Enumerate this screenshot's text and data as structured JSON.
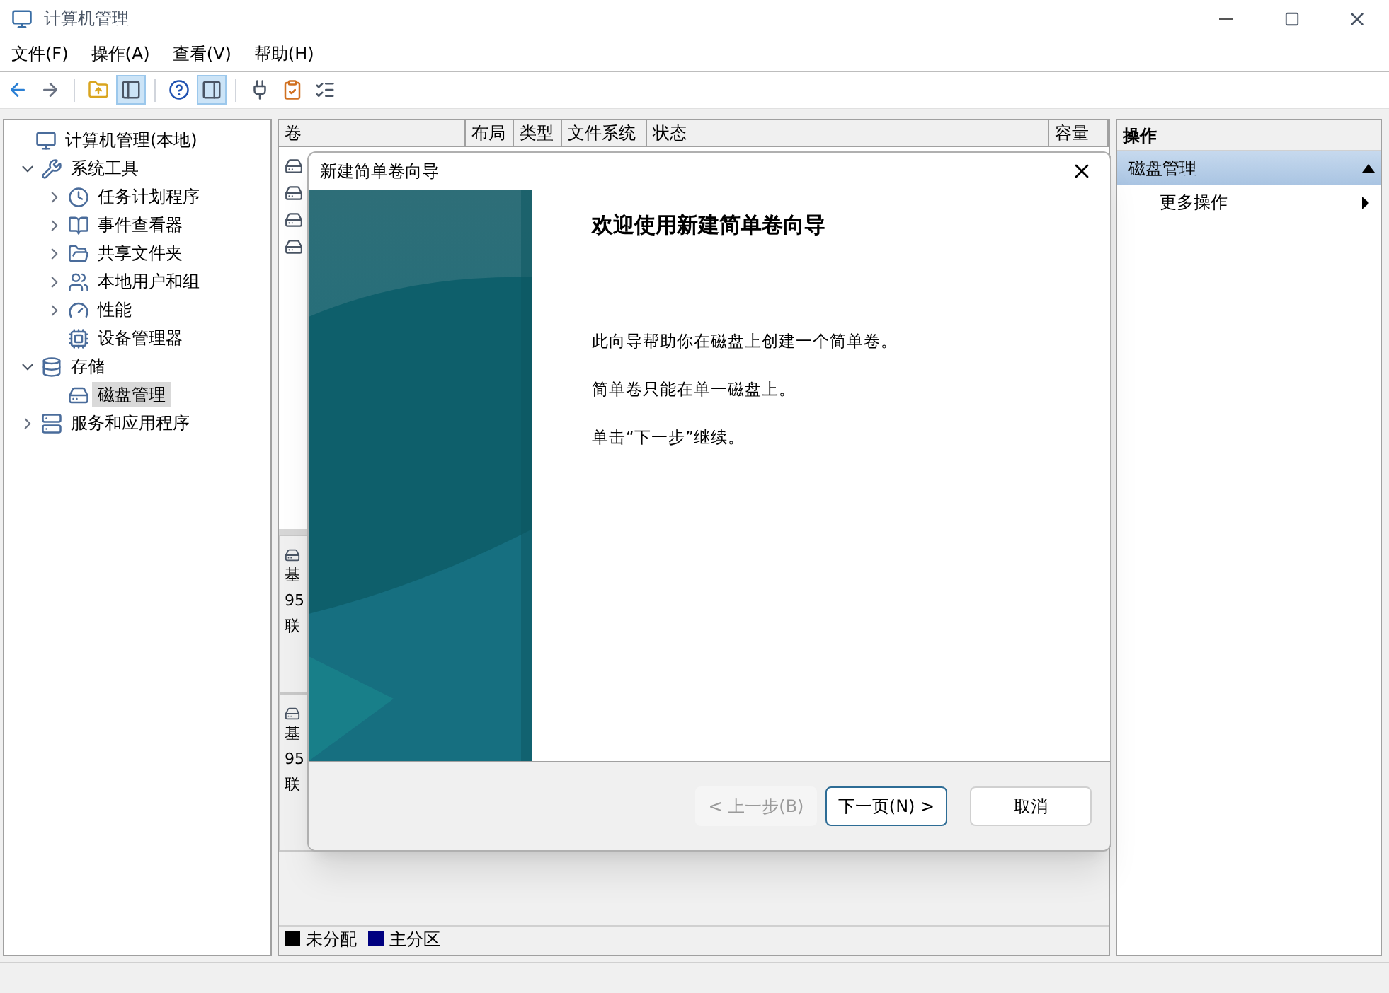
{
  "window": {
    "title": "计算机管理"
  },
  "menu": [
    "文件(F)",
    "操作(A)",
    "查看(V)",
    "帮助(H)"
  ],
  "toolbar": [
    {
      "pressed": false
    },
    {
      "pressed": false
    },
    {
      "pressed": false
    },
    {
      "pressed": true
    },
    {
      "pressed": false
    },
    {
      "pressed": true
    },
    {
      "pressed": false
    },
    {
      "pressed": false
    },
    {
      "pressed": false
    }
  ],
  "tree": [
    {
      "label": "计算机管理(本地)",
      "selected": false,
      "children": [
        {
          "label": "系统工具",
          "selected": false,
          "expanded": true,
          "children": [
            {
              "label": "任务计划程序",
              "selected": false,
              "expanded": false
            },
            {
              "label": "事件查看器",
              "selected": false,
              "expanded": false
            },
            {
              "label": "共享文件夹",
              "selected": false,
              "expanded": false
            },
            {
              "label": "本地用户和组",
              "selected": false,
              "expanded": false
            },
            {
              "label": "性能",
              "selected": false,
              "expanded": false
            },
            {
              "label": "设备管理器",
              "selected": false
            }
          ]
        },
        {
          "label": "存储",
          "selected": false,
          "expanded": true,
          "children": [
            {
              "label": "磁盘管理",
              "selected": true
            }
          ]
        },
        {
          "label": "服务和应用程序",
          "selected": false,
          "expanded": false
        }
      ]
    }
  ],
  "volume_table": {
    "columns": [
      "卷",
      "布局",
      "类型",
      "文件系统",
      "状态",
      "容量"
    ]
  },
  "disks": [
    {
      "lines": [
        "基",
        "95",
        "联"
      ]
    },
    {
      "lines": [
        "基",
        "95",
        "联"
      ]
    }
  ],
  "legend": [
    {
      "label": "未分配",
      "color": "#000000"
    },
    {
      "label": "主分区",
      "color": "#000080"
    }
  ],
  "actions": {
    "title": "操作",
    "section": {
      "label": "磁盘管理",
      "expanded": true
    },
    "items": [
      {
        "label": "更多操作"
      }
    ]
  },
  "dialog": {
    "title": "新建简单卷向导",
    "heading": "欢迎使用新建简单卷向导",
    "paragraphs": [
      "此向导帮助你在磁盘上创建一个简单卷。",
      "简单卷只能在单一磁盘上。",
      "单击“下一步”继续。"
    ],
    "buttons": [
      {
        "label": "< 上一步(B)",
        "disabled": true,
        "default": false
      },
      {
        "label": "下一页(N) >",
        "disabled": false,
        "default": true
      },
      {
        "label": "取消",
        "disabled": false,
        "default": false
      }
    ]
  }
}
